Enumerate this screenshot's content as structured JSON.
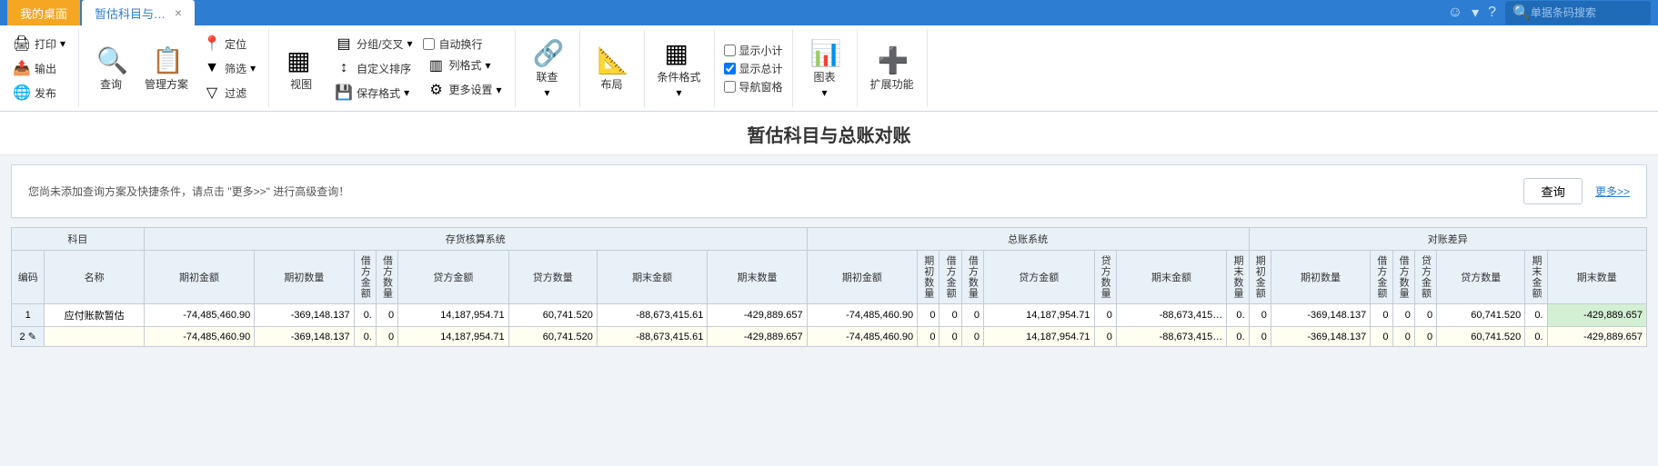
{
  "topbar": {
    "tab_desktop": "我的桌面",
    "tab_active": "暂估科目与…",
    "search_placeholder": "单据条码搜索"
  },
  "ribbon": {
    "g1": {
      "print": "打印",
      "export": "输出",
      "publish": "发布"
    },
    "g2": {
      "query": "查询",
      "plan": "管理方案"
    },
    "g3": {
      "locate": "定位",
      "filter": "筛选",
      "filter2": "过滤"
    },
    "g4": {
      "view": "视图"
    },
    "g5": {
      "group": "分组/交叉",
      "sort": "自定义排序",
      "saveformat": "保存格式"
    },
    "g6": {
      "autowrap": "自动换行",
      "colformat": "列格式",
      "moreset": "更多设置"
    },
    "g7": {
      "lianча": "联查"
    },
    "g8": {
      "layout": "布局"
    },
    "g9": {
      "condformat": "条件格式"
    },
    "g10": {
      "subtotal": "显示小计",
      "total": "显示总计",
      "navpane": "导航窗格"
    },
    "g11": {
      "chart": "图表"
    },
    "g12": {
      "extend": "扩展功能"
    }
  },
  "title": "暂估科目与总账对账",
  "querybar": {
    "text": "您尚未添加查询方案及快捷条件，请点击 \"更多>>\" 进行高级查询！",
    "btn": "查询",
    "more": "更多>>"
  },
  "table": {
    "group_headers": {
      "subject": "科目",
      "inventory": "存货核算系统",
      "ledger": "总账系统",
      "diff": "对账差异"
    },
    "headers": {
      "code": "编码",
      "name": "名称",
      "qcje": "期初金额",
      "qcsl": "期初数量",
      "jfje": "借方金额",
      "jfsl": "借方数量",
      "dfje": "贷方金额",
      "dfsl": "贷方数量",
      "qmje": "期末金额",
      "qmsl": "期末数量",
      "qcje2": "期初金额",
      "qcsl2": "期初数量",
      "jfje2": "借方金额",
      "jfsl2": "借方数量",
      "dfje2": "贷方金额",
      "dfsl2": "贷方数量",
      "qmje2": "期末金额",
      "qmsl2": "期末数量",
      "qcje3": "期初金额",
      "qcsl3": "期初数量",
      "jfje3": "借方金额",
      "jfsl3": "借方数量",
      "dfje3": "贷方金额",
      "dfsl3": "贷方数量",
      "qmje3": "期末金额",
      "qmsl3": "期末数量"
    },
    "rows": [
      {
        "idx": "1",
        "name": "应付账款暂估",
        "c": [
          "-74,485,460.90",
          "-369,148.137",
          "0.",
          "0",
          "14,187,954.71",
          "60,741.520",
          "-88,673,415.61",
          "-429,889.657",
          "-74,485,460.90",
          "0",
          "0",
          "0",
          "14,187,954.71",
          "0",
          "-88,673,415…",
          "0.",
          "0",
          "-369,148.137",
          "0",
          "0",
          "0",
          "60,741.520",
          "0.",
          "-429,889.657"
        ]
      },
      {
        "idx": "2",
        "name": "",
        "c": [
          "-74,485,460.90",
          "-369,148.137",
          "0.",
          "0",
          "14,187,954.71",
          "60,741.520",
          "-88,673,415.61",
          "-429,889.657",
          "-74,485,460.90",
          "0",
          "0",
          "0",
          "14,187,954.71",
          "0",
          "-88,673,415…",
          "0.",
          "0",
          "-369,148.137",
          "0",
          "0",
          "0",
          "60,741.520",
          "0.",
          "-429,889.657"
        ]
      }
    ]
  }
}
